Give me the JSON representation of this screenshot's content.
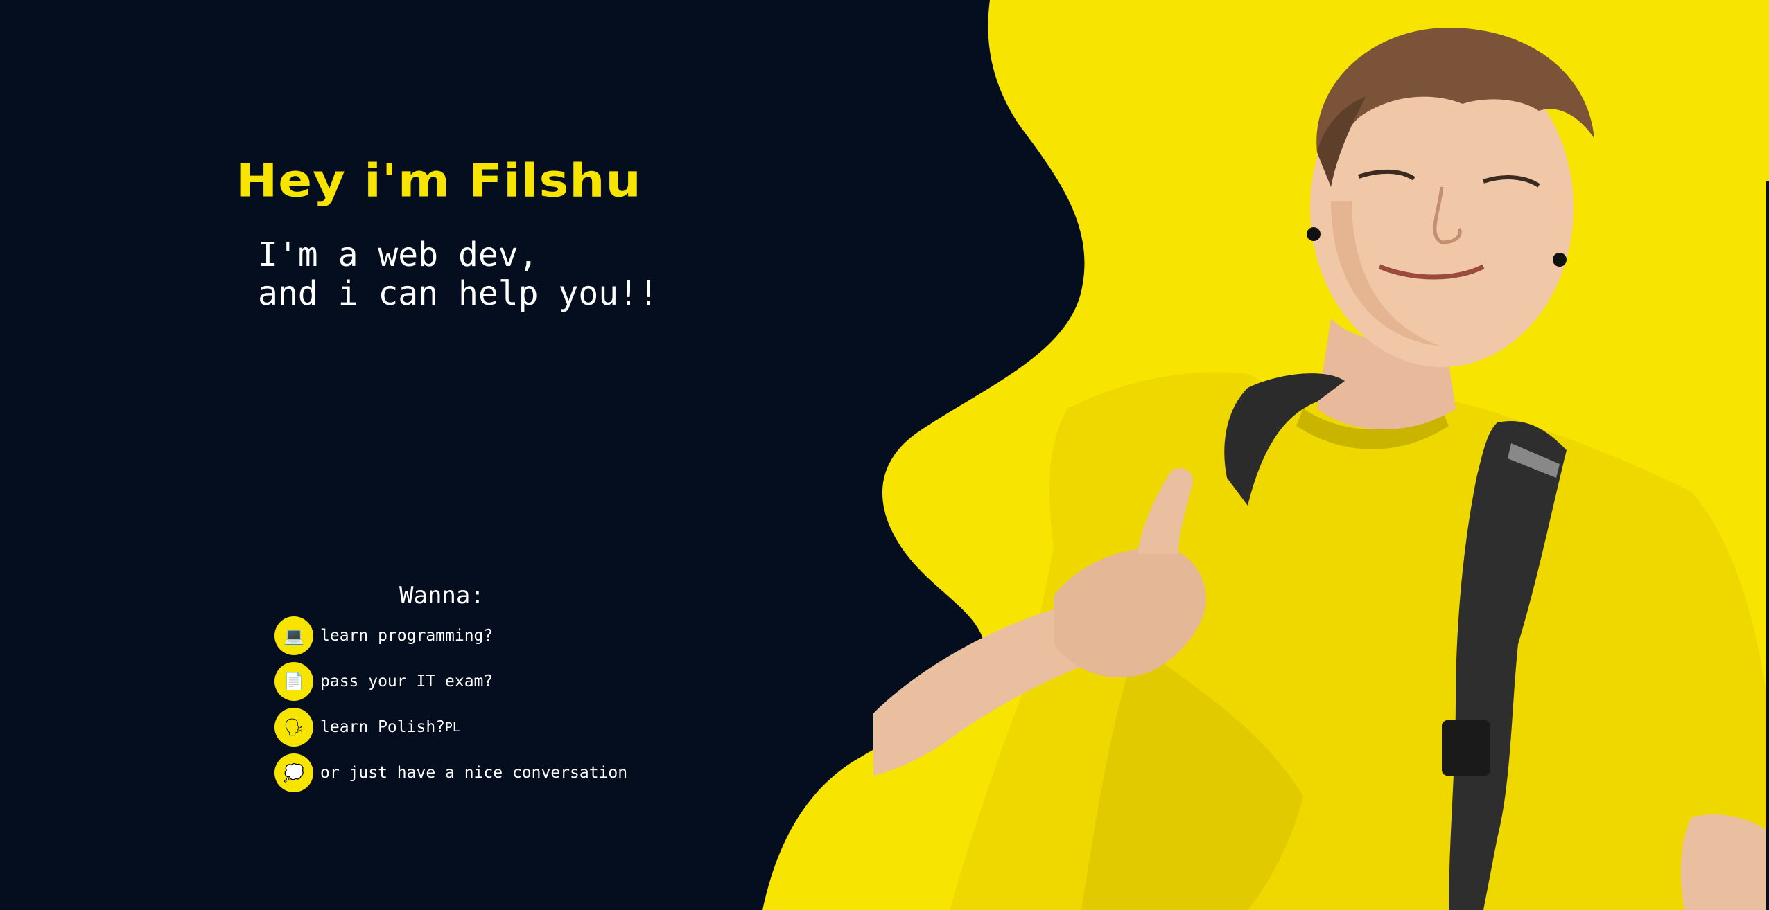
{
  "hero": {
    "title": "Hey i'm Filshu",
    "subtitle_line1": "I'm a web dev,",
    "subtitle_line2": "and i can help you!!"
  },
  "wanna": {
    "heading": "Wanna:",
    "items": [
      {
        "icon": "computer-icon",
        "glyph": "💻",
        "label": "learn programming?",
        "suffix": ""
      },
      {
        "icon": "exam-document-icon",
        "glyph": "📄",
        "label": "pass your IT exam?",
        "suffix": ""
      },
      {
        "icon": "speaking-head-icon",
        "glyph": "🗣",
        "label": "learn Polish?",
        "suffix": "PL"
      },
      {
        "icon": "speech-bubble-icon",
        "glyph": "💭",
        "label": "or just have a nice conversation",
        "suffix": ""
      }
    ]
  },
  "colors": {
    "background": "#040e1f",
    "accent": "#f7e400",
    "text": "#ffffff"
  }
}
